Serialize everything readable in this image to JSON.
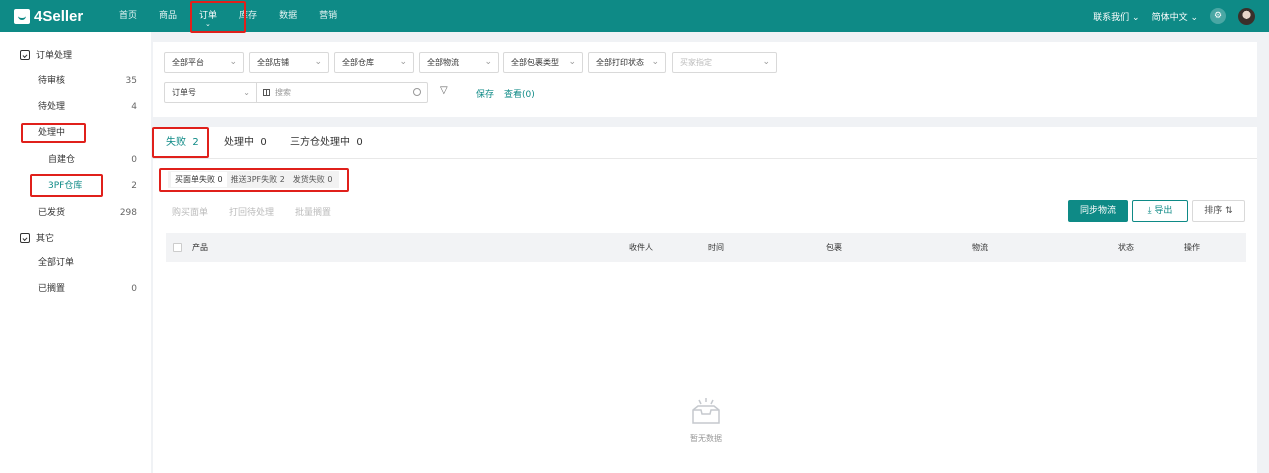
{
  "brand": {
    "name": "4Seller"
  },
  "nav": {
    "items": [
      "首页",
      "商品",
      "订单",
      "库存",
      "数据",
      "营销"
    ],
    "active_caret": "⌄"
  },
  "top_right": {
    "contact": "联系我们",
    "language": "简体中文"
  },
  "sidebar": {
    "group1": "订单处理",
    "items1": [
      {
        "label": "待审核",
        "count": "35"
      },
      {
        "label": "待处理",
        "count": "4"
      },
      {
        "label": "处理中",
        "count": ""
      },
      {
        "label": "自建仓",
        "count": "0"
      },
      {
        "label": "3PF仓库",
        "count": "2"
      },
      {
        "label": "已发货",
        "count": "298"
      }
    ],
    "group2": "其它",
    "items2": [
      {
        "label": "全部订单",
        "count": ""
      },
      {
        "label": "已搁置",
        "count": "0"
      }
    ]
  },
  "filters": {
    "selects": [
      "全部平台",
      "全部店铺",
      "全部仓库",
      "全部物流",
      "全部包裹类型",
      "全部打印状态"
    ],
    "buyer_placeholder": "买家指定",
    "search_type": "订单号",
    "search_placeholder": "搜索",
    "save": "保存",
    "view": "查看(0)"
  },
  "tabs": [
    {
      "label": "失败",
      "count": "2"
    },
    {
      "label": "处理中",
      "count": "0"
    },
    {
      "label": "三方仓处理中",
      "count": "0"
    }
  ],
  "subtabs": [
    {
      "label": "买面单失败",
      "count": "0"
    },
    {
      "label": "推送3PF失败",
      "count": "2"
    },
    {
      "label": "发货失败",
      "count": "0"
    }
  ],
  "actions": [
    "购买面单",
    "打回待处理",
    "批量搁置"
  ],
  "buttons": {
    "sync": "同步物流",
    "export": "导出",
    "sort": "排序"
  },
  "table": {
    "columns": [
      "产品",
      "收件人",
      "时间",
      "包裹",
      "物流",
      "状态",
      "操作"
    ]
  },
  "empty_text": "暂无数据",
  "colors": {
    "brand": "#0e8a86",
    "highlight": "#e0201b"
  }
}
